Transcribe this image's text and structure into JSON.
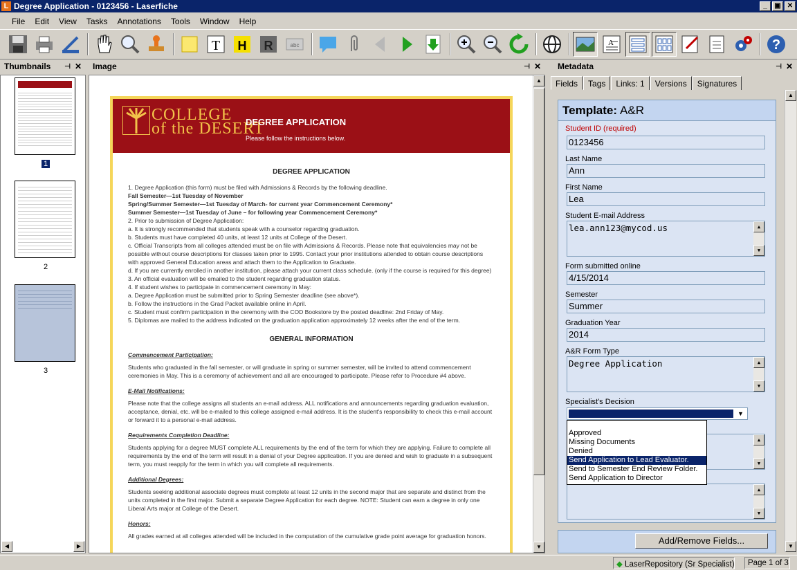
{
  "window": {
    "title": "Degree Application - 0123456 - Laserfiche",
    "icon_letter": "L",
    "min": "_",
    "max": "▣",
    "close": "✕"
  },
  "menu": [
    "File",
    "Edit",
    "View",
    "Tasks",
    "Annotations",
    "Tools",
    "Window",
    "Help"
  ],
  "panes": {
    "thumbnails": "Thumbnails",
    "image": "Image",
    "metadata": "Metadata",
    "pin": "⊣",
    "close": "✕"
  },
  "thumbnails": [
    {
      "num": "1",
      "selected": true
    },
    {
      "num": "2",
      "selected": false
    },
    {
      "num": "3",
      "selected": false
    }
  ],
  "document": {
    "logo_line1": "COLLEGE",
    "logo_line2": "of the DESERT",
    "banner_title": "DEGREE APPLICATION",
    "banner_sub": "Please follow the instructions below.",
    "heading": "DEGREE APPLICATION",
    "lines": [
      "1. Degree Application (this form) must be filed with Admissions & Records by the following deadline.",
      "Fall Semester—1st Tuesday of November",
      "Spring/Summer Semester—1st Tuesday of March- for current year Commencement Ceremony*",
      "Summer Semester—1st Tuesday of June – for following year Commencement Ceremony*",
      "2. Prior to submission of Degree Application:",
      "a. It is strongly recommended that students speak with a counselor regarding graduation.",
      "b. Students must have completed 40 units, at least 12 units at College of the Desert.",
      "c. Official Transcripts from all colleges attended must be on file with Admissions & Records. Please note that equivalencies may not be possible without course descriptions for classes taken prior to 1995. Contact your prior institutions attended to obtain course descriptions with approved General Education areas and attach them to the Application to Graduate.",
      "d. If you are currently enrolled in another institution, please attach your current class schedule. (only if the course is required for this degree)",
      "3. An official evaluation will be emailed to the student regarding graduation status.",
      "4. If student wishes to participate in commencement ceremony in May:",
      "a. Degree Application must be submitted prior to Spring Semester deadline (see above*).",
      "b. Follow the instructions in the Grad Packet available online in April.",
      "c. Student must confirm participation in the ceremony with the COD Bookstore by the posted deadline: 2nd Friday of May.",
      "5. Diplomas are mailed to the address indicated on the graduation application approximately 12 weeks after the end of the term."
    ],
    "general_heading": "GENERAL INFORMATION",
    "sections": [
      {
        "title": "Commencement Participation:",
        "text": "Students who graduated in the fall semester, or will graduate in spring or summer semester, will be invited to attend commencement ceremonies in May. This is a ceremony of achievement and all are encouraged to participate. Please refer to Procedure #4 above."
      },
      {
        "title": "E-Mail Notifications:",
        "text": "Please note that the college assigns all students an e-mail address. ALL notifications and announcements regarding graduation evaluation, acceptance, denial, etc. will be e-mailed to this college assigned e-mail address. It is the student's responsibility to check this e-mail account or forward it to a personal e-mail address."
      },
      {
        "title": "Requirements Completion Deadline:",
        "text": "Students applying for a degree MUST complete ALL requirements by the end of the term for which they are applying. Failure to complete all requirements by the end of the term will result in a denial of your Degree application. If you are denied and wish to graduate in a subsequent term, you must reapply for the term in which you will complete all requirements."
      },
      {
        "title": "Additional Degrees:",
        "text": "Students seeking additional associate degrees must complete at least 12 units in the second major that are separate and distinct from the units completed in the first major. Submit a separate Degree Application for each degree. NOTE: Student can earn a degree in only one Liberal Arts major at College of the Desert."
      },
      {
        "title": "Honors:",
        "text": "All grades earned at all colleges attended will be included in the computation of the cumulative grade point average for graduation honors."
      }
    ]
  },
  "metadata": {
    "tabs": [
      "Fields",
      "Tags",
      "Links: 1",
      "Versions",
      "Signatures"
    ],
    "template_label": "Template:",
    "template_name": "A&R",
    "fields": {
      "student_id_label": "Student ID (required)",
      "student_id": "0123456",
      "last_name_label": "Last Name",
      "last_name": "Ann",
      "first_name_label": "First Name",
      "first_name": "Lea",
      "email_label": "Student E-mail Address",
      "email": "lea.ann123@mycod.us",
      "submitted_label": "Form submitted online",
      "submitted": "4/15/2014",
      "semester_label": "Semester",
      "semester": "Summer",
      "grad_year_label": "Graduation Year",
      "grad_year": "2014",
      "form_type_label": "A&R Form Type",
      "form_type": "Degree Application",
      "decision_label": "Specialist's Decision"
    },
    "decision_options": [
      "Approved",
      "Missing Documents",
      "Denied",
      "Send Application to Lead Evaluator.",
      "Send to Semester End Review Folder.",
      "Send Application to Director"
    ],
    "decision_highlighted": "Send Application to Lead Evaluator.",
    "add_remove": "Add/Remove Fields..."
  },
  "status": {
    "repository": "LaserRepository (Sr Specialist)",
    "page": "Page 1 of 3"
  },
  "colors": {
    "title_bar": "#0a246a",
    "banner": "#9b1016",
    "panel": "#dbe4f3"
  }
}
